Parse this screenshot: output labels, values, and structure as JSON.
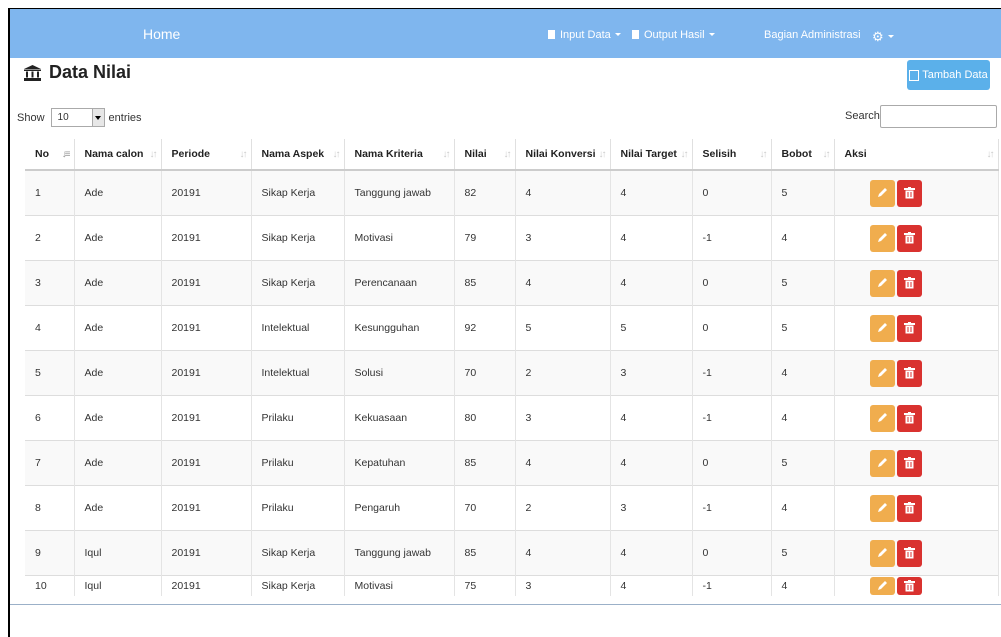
{
  "navbar": {
    "home": "Home",
    "input_data": "Input Data",
    "output_hasil": "Output Hasil",
    "user": "Bagian Administrasi",
    "bg_color": "#7fb6ee"
  },
  "page": {
    "title": "Data Nilai",
    "title_icon": "bank-icon",
    "add_button": "Tambah Data"
  },
  "controls": {
    "show_label": "Show",
    "entries_value": "10",
    "entries_label": "entries",
    "search_label": "Search:",
    "search_value": ""
  },
  "table": {
    "columns": [
      "No",
      "Nama calon",
      "Periode",
      "Nama Aspek",
      "Nama Kriteria",
      "Nilai",
      "Nilai Konversi",
      "Nilai Target",
      "Selisih",
      "Bobot",
      "Aksi"
    ],
    "rows": [
      [
        "1",
        "Ade",
        "20191",
        "Sikap Kerja",
        "Tanggung jawab",
        "82",
        "4",
        "4",
        "0",
        "5"
      ],
      [
        "2",
        "Ade",
        "20191",
        "Sikap Kerja",
        "Motivasi",
        "79",
        "3",
        "4",
        "-1",
        "4"
      ],
      [
        "3",
        "Ade",
        "20191",
        "Sikap Kerja",
        "Perencanaan",
        "85",
        "4",
        "4",
        "0",
        "5"
      ],
      [
        "4",
        "Ade",
        "20191",
        "Intelektual",
        "Kesungguhan",
        "92",
        "5",
        "5",
        "0",
        "5"
      ],
      [
        "5",
        "Ade",
        "20191",
        "Intelektual",
        "Solusi",
        "70",
        "2",
        "3",
        "-1",
        "4"
      ],
      [
        "6",
        "Ade",
        "20191",
        "Prilaku",
        "Kekuasaan",
        "80",
        "3",
        "4",
        "-1",
        "4"
      ],
      [
        "7",
        "Ade",
        "20191",
        "Prilaku",
        "Kepatuhan",
        "85",
        "4",
        "4",
        "0",
        "5"
      ],
      [
        "8",
        "Ade",
        "20191",
        "Prilaku",
        "Pengaruh",
        "70",
        "2",
        "3",
        "-1",
        "4"
      ],
      [
        "9",
        "Iqul",
        "20191",
        "Sikap Kerja",
        "Tanggung jawab",
        "85",
        "4",
        "4",
        "0",
        "5"
      ],
      [
        "10",
        "Iqul",
        "20191",
        "Sikap Kerja",
        "Motivasi",
        "75",
        "3",
        "4",
        "-1",
        "4"
      ]
    ],
    "edit_icon": "pencil-icon",
    "delete_icon": "trash-icon",
    "edit_color": "#f0ad4e",
    "delete_color": "#d9322f"
  }
}
